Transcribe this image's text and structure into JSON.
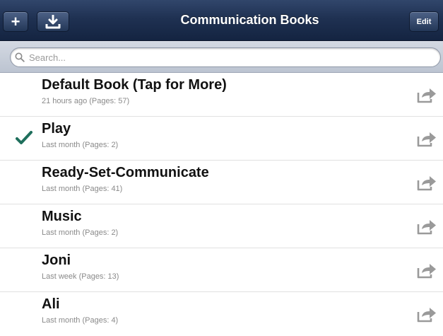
{
  "navbar": {
    "title": "Communication Books",
    "add_label": "+",
    "download_icon": "download-icon",
    "edit_label": "Edit"
  },
  "search": {
    "placeholder": "Search...",
    "icon": "search-icon"
  },
  "books": [
    {
      "title": "Default Book (Tap for More)",
      "meta": "21 hours ago (Pages: 57)",
      "selected": false
    },
    {
      "title": "Play",
      "meta": "Last month (Pages: 2)",
      "selected": true
    },
    {
      "title": "Ready-Set-Communicate",
      "meta": "Last month (Pages: 41)",
      "selected": false
    },
    {
      "title": "Music",
      "meta": "Last month (Pages: 2)",
      "selected": false
    },
    {
      "title": "Joni",
      "meta": "Last week (Pages: 13)",
      "selected": false
    },
    {
      "title": "Ali",
      "meta": "Last month (Pages: 4)",
      "selected": false
    }
  ],
  "colors": {
    "navbar": "#1f3152",
    "checkmark": "#1f6f5c",
    "share_icon": "#9a9a9a"
  }
}
